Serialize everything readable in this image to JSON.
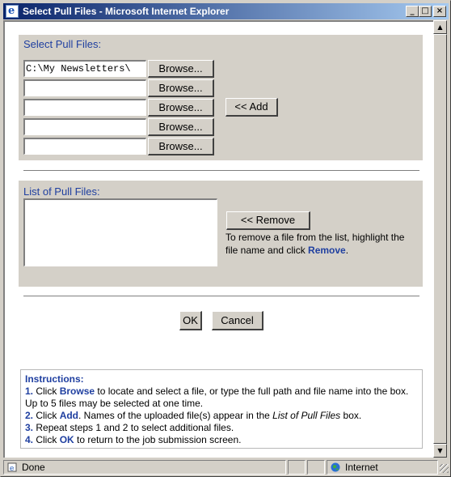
{
  "window": {
    "title": "Select Pull Files - Microsoft Internet Explorer",
    "icon": "ie-page-icon",
    "controls": [
      "minimize",
      "maximize",
      "close"
    ]
  },
  "select_panel": {
    "label": "Select Pull Files:",
    "file_inputs": [
      {
        "value": "C:\\My Newsletters\\"
      },
      {
        "value": ""
      },
      {
        "value": ""
      },
      {
        "value": ""
      },
      {
        "value": ""
      }
    ],
    "browse_label": "Browse...",
    "add_label": "<< Add"
  },
  "list_panel": {
    "label": "List of Pull Files:",
    "remove_label": "<< Remove",
    "help_prefix": "To remove a file from the list, highlight the file name and click ",
    "help_keyword": "Remove",
    "help_suffix": "."
  },
  "dialog_buttons": {
    "ok": "OK",
    "cancel": "Cancel"
  },
  "instructions": {
    "title": "Instructions:",
    "step1_num": "1.",
    "step1_a": " Click ",
    "step1_kw": "Browse",
    "step1_b": " to locate and select a file, or type the full path and file name into the box. Up to 5 files may be selected at one time.",
    "step2_num": "2.",
    "step2_a": " Click ",
    "step2_kw": "Add",
    "step2_b": ". Names of the uploaded file(s) appear in the ",
    "step2_em": "List of Pull Files",
    "step2_c": " box.",
    "step3_num": "3.",
    "step3_a": " Repeat steps 1 and 2 to select additional files.",
    "step4_num": "4.",
    "step4_a": " Click ",
    "step4_kw": "OK",
    "step4_b": " to return to the job submission screen."
  },
  "statusbar": {
    "status": "Done",
    "zone": "Internet"
  },
  "colors": {
    "accent": "#1f3fa0",
    "face": "#d4d0c8",
    "titlebar_start": "#0a246a",
    "titlebar_end": "#a6caf0"
  }
}
